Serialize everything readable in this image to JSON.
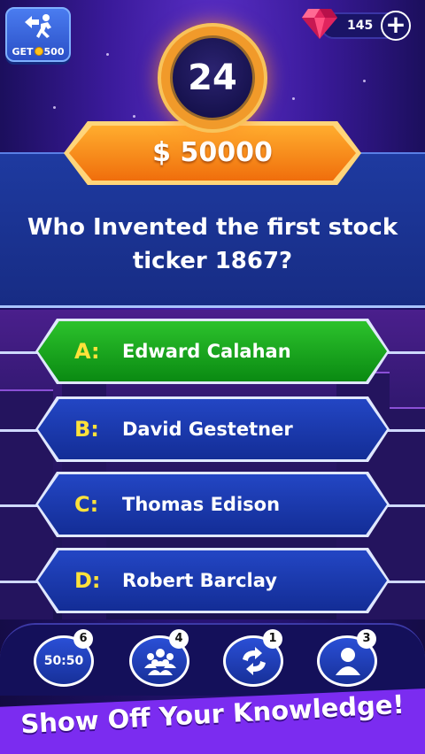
{
  "exit_button": {
    "label_prefix": "GET",
    "coin_amount": "500",
    "icon": "exit-run-icon"
  },
  "gems": {
    "count": "145",
    "icon": "gem-icon",
    "add_label": "+"
  },
  "timer": {
    "seconds": "24"
  },
  "prize": {
    "amount": "$ 50000"
  },
  "question": {
    "text": "Who Invented the first stock ticker 1867?"
  },
  "answers": [
    {
      "letter": "A:",
      "text": "Edward Calahan",
      "state": "correct"
    },
    {
      "letter": "B:",
      "text": "David Gestetner",
      "state": "normal"
    },
    {
      "letter": "C:",
      "text": "Thomas Edison",
      "state": "normal"
    },
    {
      "letter": "D:",
      "text": "Robert Barclay",
      "state": "normal"
    }
  ],
  "lifelines": [
    {
      "name": "fifty-fifty",
      "label": "50:50",
      "count": "6",
      "icon": ""
    },
    {
      "name": "ask-audience",
      "label": "",
      "count": "4",
      "icon": "audience-icon"
    },
    {
      "name": "swap-question",
      "label": "",
      "count": "1",
      "icon": "refresh-icon"
    },
    {
      "name": "call-friend",
      "label": "",
      "count": "3",
      "icon": "person-icon"
    }
  ],
  "banner": {
    "text": "Show Off Your Knowledge!"
  },
  "colors": {
    "correct": "#0a8a12",
    "answer": "#132d96",
    "prize": "#f06e0c",
    "banner": "#7b2cf0",
    "letter": "#ffe23a"
  }
}
